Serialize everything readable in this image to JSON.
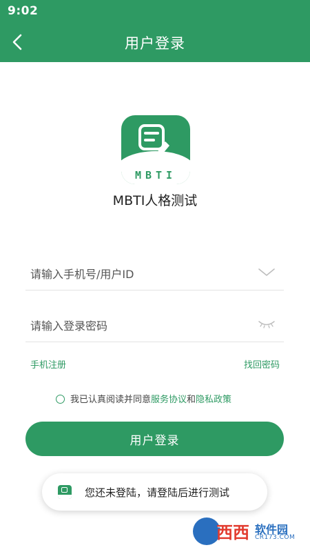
{
  "status_bar": {
    "time": "9:02"
  },
  "nav": {
    "title": "用户登录",
    "back_icon": "chevron-left-icon"
  },
  "app": {
    "logo_text": "MBTI",
    "name": "MBTI人格测试"
  },
  "form": {
    "account_placeholder": "请输入手机号/用户ID",
    "account_value": "",
    "account_dropdown_icon": "chevron-down-icon",
    "password_placeholder": "请输入登录密码",
    "password_value": "",
    "password_toggle_icon": "eye-closed-icon"
  },
  "links": {
    "register": "手机注册",
    "forgot_password": "找回密码"
  },
  "agreement": {
    "checked": false,
    "prefix": "我已认真阅读并同意",
    "service": "服务协议",
    "and": "和",
    "privacy": "隐私政策"
  },
  "login_button": "用户登录",
  "toast": {
    "message": "您还未登陆，请登陆后进行测试"
  },
  "watermark": {
    "main": "西西",
    "brand": "软件园",
    "url": "CR173.COM"
  },
  "colors": {
    "primary": "#2e9a63",
    "background": "#ffffff",
    "text": "#222222",
    "divider": "#e2e2e2"
  }
}
